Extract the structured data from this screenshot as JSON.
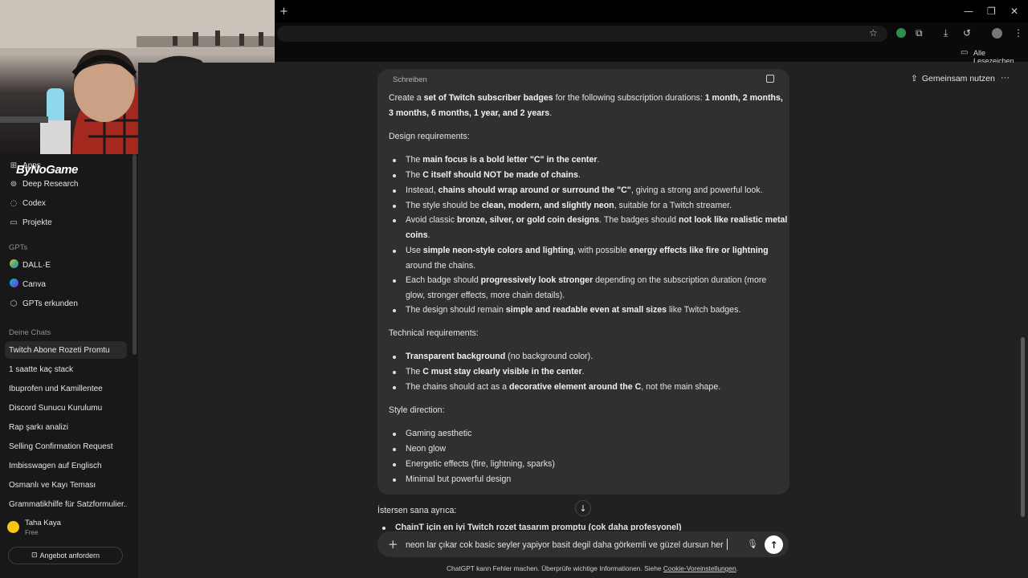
{
  "browser": {
    "new_tab": "+",
    "bookmarks_label": "Alle Lesezeichen",
    "window_min": "—",
    "window_restore": "❐",
    "window_close": "✕"
  },
  "overlay": {
    "channel_name": "ByNoGame"
  },
  "sidebar": {
    "apps": "Apps",
    "deep_research": "Deep Research",
    "codex": "Codex",
    "projects": "Projekte",
    "gpts_heading": "GPTs",
    "gpts": [
      "DALL·E",
      "Canva",
      "GPTs erkunden"
    ],
    "chats_heading": "Deine Chats",
    "chats": [
      "Twitch Abone Rozeti Promtu",
      "1 saatte kaç stack",
      "Ibuprofen und Kamillentee",
      "Discord Sunucu Kurulumu",
      "Rap şarkı analizi",
      "Selling Confirmation Request",
      "Imbisswagen auf Englisch",
      "Osmanlı ve Kayı Teması",
      "Grammatikhilfe für Satzformulier..."
    ],
    "user_name": "Taha Kaya",
    "user_plan": "Free",
    "upgrade_button": "Angebot anfordern"
  },
  "header": {
    "share": "Gemeinsam nutzen",
    "more": "···"
  },
  "message": {
    "label": "Schreiben",
    "intro_1": "Create a ",
    "intro_b1": "set of Twitch subscriber badges",
    "intro_2": " for the following subscription durations: ",
    "intro_b2": "1 month, 2 months,",
    "intro_b3": "3 months, 6 months, 1 year, and 2 years",
    "intro_end": ".",
    "design_heading": "Design requirements:",
    "d1_a": "The ",
    "d1_b": "main focus is a bold letter \"C\" in the center",
    "d1_c": ".",
    "d2_a": "The ",
    "d2_b": "C itself should NOT be made of chains",
    "d2_c": ".",
    "d3_a": "Instead, ",
    "d3_b": "chains should wrap around or surround the \"C\"",
    "d3_c": ", giving a strong and powerful look.",
    "d4_a": "The style should be ",
    "d4_b": "clean, modern, and slightly neon",
    "d4_c": ", suitable for a Twitch streamer.",
    "d5_a": "Avoid classic ",
    "d5_b": "bronze, silver, or gold coin designs",
    "d5_c": ". The badges should ",
    "d5_d": "not look like realistic metal",
    "d5_e": "coins",
    "d5_f": ".",
    "d6_a": "Use ",
    "d6_b": "simple neon-style colors and lighting",
    "d6_c": ", with possible ",
    "d6_d": "energy effects like fire or lightning",
    "d6_e": "around the chains.",
    "d7_a": "Each badge should ",
    "d7_b": "progressively look stronger",
    "d7_c": " depending on the subscription duration (more",
    "d7_d": "glow, stronger effects, more chain details).",
    "d8_a": "The design should remain ",
    "d8_b": "simple and readable even at small sizes",
    "d8_c": " like Twitch badges.",
    "tech_heading": "Technical requirements:",
    "t1_b": "Transparent background",
    "t1_c": " (no background color).",
    "t2_a": "The ",
    "t2_b": "C must stay clearly visible in the center",
    "t2_c": ".",
    "t3_a": "The chains should act as a ",
    "t3_b": "decorative element around the C",
    "t3_c": ", not the main shape.",
    "style_heading": "Style direction:",
    "s1": "Gaming aesthetic",
    "s2": "Neon glow",
    "s3": "Energetic effects (fire, lightning, sparks)",
    "s4": "Minimal but powerful design"
  },
  "reply": {
    "intro": "İstersen sana ayrıca:",
    "item1": "ChainT için en iyi Twitch rozet tasarım promptu (çok daha profesyonel)"
  },
  "composer": {
    "value": "neon lar çıkar cok basic seyler yapiyor basit degil daha görkemli ve güzel dursun her"
  },
  "footer": {
    "text": "ChatGPT kann Fehler machen. Überprüfe wichtige Informationen. Siehe ",
    "link": "Cookie-Voreinstellungen",
    "end": "."
  },
  "colors": {
    "background": "#212121",
    "sidebar": "#181818",
    "bubble": "#303030",
    "send_button": "#ffffff",
    "avatar": "#f5c518"
  }
}
